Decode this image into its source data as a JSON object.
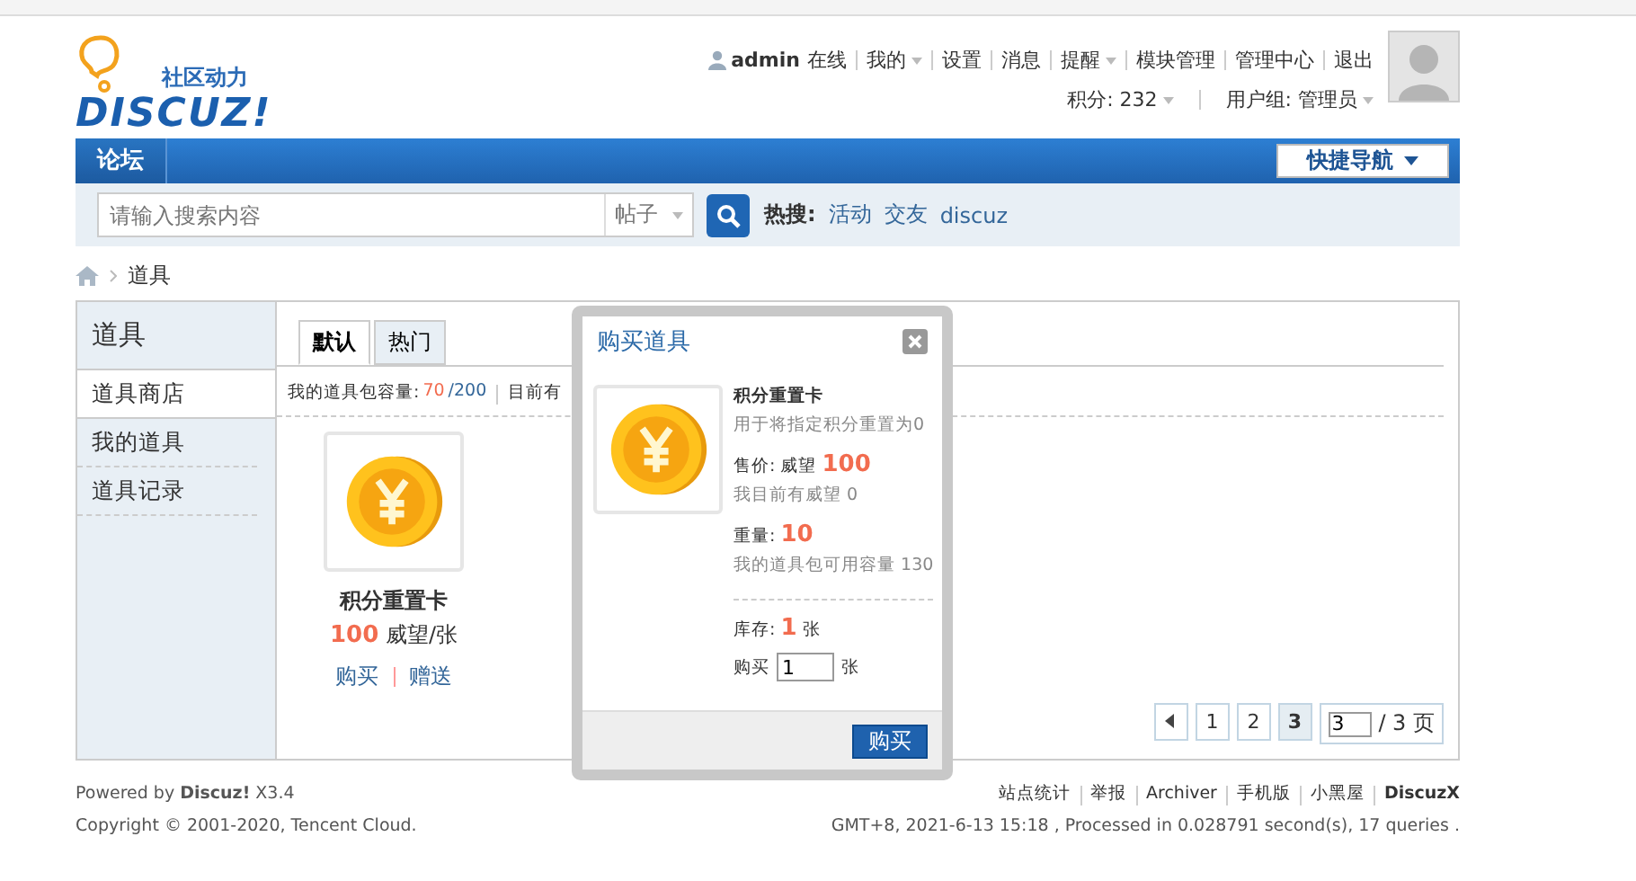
{
  "header": {
    "logo_tagline": "社区动力",
    "logo_text": "DISCUZ!",
    "user": "admin",
    "status": "在线",
    "menu": [
      {
        "label": "我的",
        "dropdown": true
      },
      {
        "label": "设置",
        "dropdown": false
      },
      {
        "label": "消息",
        "dropdown": false
      },
      {
        "label": "提醒",
        "dropdown": true
      },
      {
        "label": "模块管理",
        "dropdown": false
      },
      {
        "label": "管理中心",
        "dropdown": false
      },
      {
        "label": "退出",
        "dropdown": false
      }
    ],
    "credits": "积分: 232",
    "usergroup": "用户组: 管理员"
  },
  "nav": {
    "items": [
      {
        "label": "论坛",
        "selected": true
      }
    ],
    "quick_nav": "快捷导航"
  },
  "search": {
    "placeholder": "请输入搜索内容",
    "scope": "帖子",
    "hot_label": "热搜:",
    "hot": [
      "活动",
      "交友",
      "discuz"
    ]
  },
  "breadcrumb": [
    "道具"
  ],
  "sidebar": {
    "title": "道具",
    "items": [
      {
        "label": "道具商店",
        "selected": true
      },
      {
        "label": "我的道具",
        "selected": false
      },
      {
        "label": "道具记录",
        "selected": false
      }
    ]
  },
  "tabs": [
    {
      "label": "默认",
      "selected": true
    },
    {
      "label": "热门",
      "selected": false
    }
  ],
  "capacity": {
    "label": "我的道具包容量:",
    "used": "70",
    "total": "/200",
    "note": "目前有"
  },
  "items": [
    {
      "name": "积分重置卡",
      "price": "100",
      "unit": "威望/张",
      "actions": [
        "购买",
        "赠送"
      ]
    }
  ],
  "pagination": {
    "pages": [
      {
        "label": "1",
        "selected": false
      },
      {
        "label": "2",
        "selected": false
      },
      {
        "label": "3",
        "selected": true
      }
    ],
    "input": "3",
    "total": "/ 3 页"
  },
  "dialog": {
    "title": "购买道具",
    "name": "积分重置卡",
    "description": "用于将指定积分重置为0",
    "price_label": "售价: 威望",
    "price": "100",
    "current": "我目前有威望 0",
    "weight_label": "重量:",
    "weight": "10",
    "capacity": "我的道具包可用容量 130",
    "stock_label": "库存:",
    "stock": "1",
    "stock_unit": "张",
    "buy_label": "购买",
    "quantity": "1",
    "quantity_unit": "张",
    "button": "购买"
  },
  "footer": {
    "powered": "Powered by **Discuz!** X3.4",
    "copyright": "Copyright © 2001-2020, Tencent Cloud.",
    "links": [
      {
        "label": "站点统计",
        "bold": false
      },
      {
        "label": "举报",
        "bold": false
      },
      {
        "label": "Archiver",
        "bold": false
      },
      {
        "label": "手机版",
        "bold": false
      },
      {
        "label": "小黑屋",
        "bold": false
      },
      {
        "label": "DiscuzX",
        "bold": true
      }
    ],
    "stats": "GMT+8, 2021-6-13 15:18 , Processed in 0.028791 second(s), 17 queries ."
  }
}
